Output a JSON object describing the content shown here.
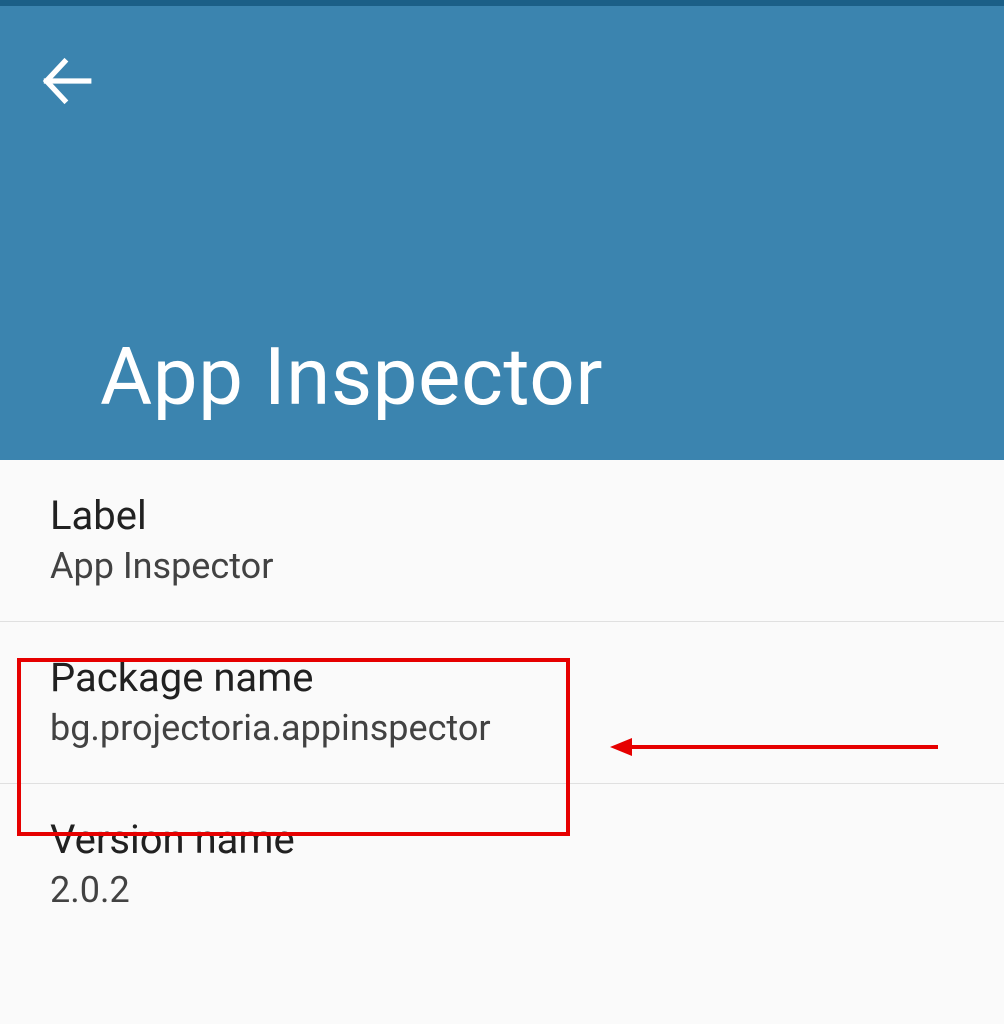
{
  "header": {
    "title": "App Inspector"
  },
  "items": [
    {
      "label": "Label",
      "value": "App Inspector"
    },
    {
      "label": "Package name",
      "value": "bg.projectoria.appinspector"
    },
    {
      "label": "Version name",
      "value": "2.0.2"
    }
  ]
}
